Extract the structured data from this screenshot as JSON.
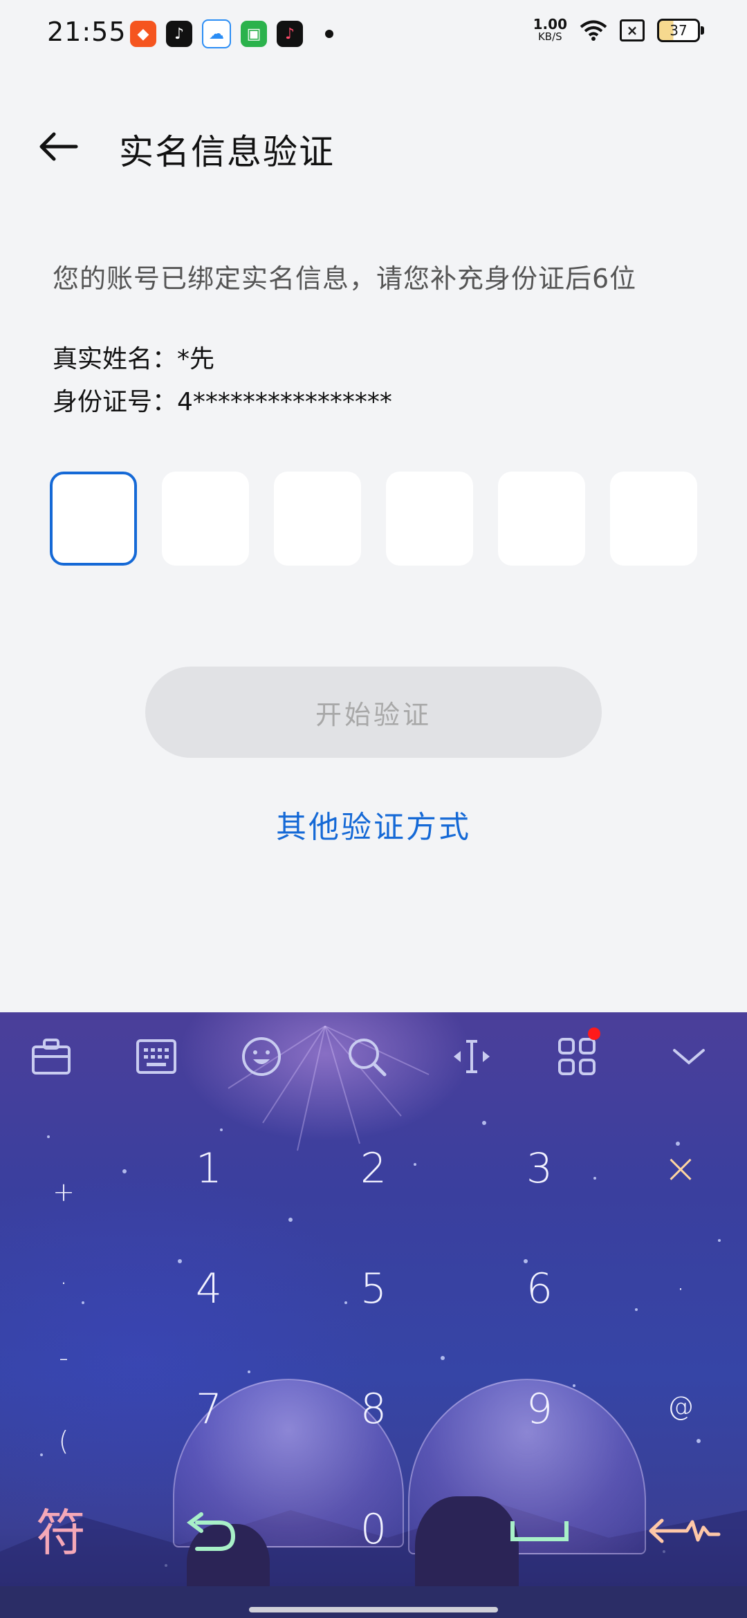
{
  "status_bar": {
    "time": "21:55",
    "net_speed_value": "1.00",
    "net_speed_unit": "KB/S",
    "battery_level": "37",
    "icons": [
      "taobao-icon",
      "tiktok-icon",
      "baidu-netdisk-icon",
      "wechat-mini-icon",
      "tiktok-lite-icon",
      "wifi-icon",
      "no-sim-icon",
      "battery-icon"
    ]
  },
  "header": {
    "title": "实名信息验证"
  },
  "main": {
    "hint": "您的账号已绑定实名信息，请您补充身份证后6位",
    "name_label": "真实姓名：",
    "name_value": "*先",
    "id_label": "身份证号：",
    "id_value": "4****************",
    "code_length": 6,
    "start_button": "开始验证",
    "other_method_link": "其他验证方式"
  },
  "keyboard": {
    "toolbar_icons": [
      "toolbox-icon",
      "keyboard-icon",
      "emoji-icon",
      "search-icon",
      "cursor-move-icon",
      "apps-icon",
      "collapse-icon"
    ],
    "left_keys": [
      "+",
      ".",
      "-",
      "("
    ],
    "right_keys": [
      "×",
      "·",
      "@"
    ],
    "num_keys": [
      "1",
      "2",
      "3",
      "4",
      "5",
      "6",
      "7",
      "8",
      "9",
      "0"
    ],
    "symbol_key": "符",
    "colors": {
      "accent": "#1569d6",
      "keyboard_bg": "#3a3f9e",
      "notif_dot": "#ff1a1a"
    }
  }
}
